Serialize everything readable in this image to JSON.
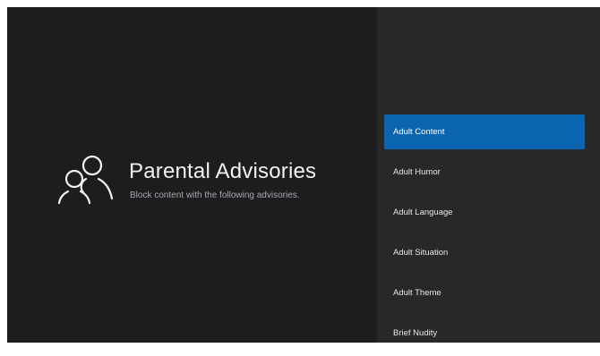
{
  "header": {
    "title": "Parental Advisories",
    "subtitle": "Block content with the following advisories."
  },
  "icons": {
    "header_icon": "people-outline-icon"
  },
  "colors": {
    "background": "#1d1d20",
    "panel": "#28282b",
    "accent": "#0a64b0",
    "text": "#f2f2f2"
  },
  "menu": {
    "items": [
      {
        "label": "Adult Content",
        "selected": true
      },
      {
        "label": "Adult Humor",
        "selected": false
      },
      {
        "label": "Adult Language",
        "selected": false
      },
      {
        "label": "Adult Situation",
        "selected": false
      },
      {
        "label": "Adult Theme",
        "selected": false
      },
      {
        "label": "Brief Nudity",
        "selected": false
      }
    ]
  }
}
